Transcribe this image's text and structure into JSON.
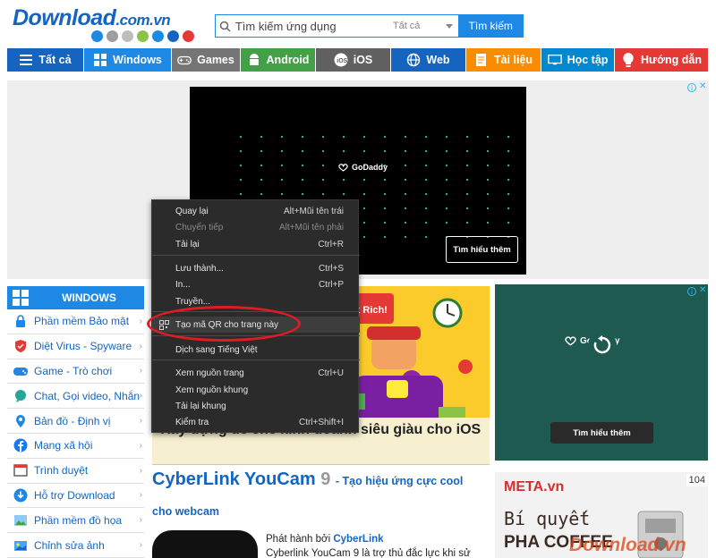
{
  "header": {
    "logo_text": "Download",
    "logo_suffix": ".com.vn",
    "logo_dot_colors": [
      "#1e88e5",
      "#9e9e9e",
      "#bdbdbd",
      "#8bc34a",
      "#1e88e5",
      "#1565c0",
      "#e53935"
    ],
    "search": {
      "placeholder": "Tìm kiếm ứng dụng",
      "filter": "Tất cả",
      "button": "Tìm kiếm"
    }
  },
  "nav": [
    {
      "label": "Tất cả",
      "color": "#1565c0",
      "icon": "menu-icon"
    },
    {
      "label": "Windows",
      "color": "#1e88e5",
      "icon": "windows-icon"
    },
    {
      "label": "Games",
      "color": "#757575",
      "icon": "gamepad-icon"
    },
    {
      "label": "Android",
      "color": "#43a047",
      "icon": "android-icon"
    },
    {
      "label": "iOS",
      "color": "#616161",
      "icon": "ios-icon"
    },
    {
      "label": "Web",
      "color": "#1565c0",
      "icon": "globe-icon"
    },
    {
      "label": "Tài liệu",
      "color": "#fb8c00",
      "icon": "document-icon"
    },
    {
      "label": "Học tập",
      "color": "#0288d1",
      "icon": "monitor-icon"
    },
    {
      "label": "Hướng dẫn",
      "color": "#e53935",
      "icon": "lightbulb-icon"
    }
  ],
  "ads": {
    "top_video": {
      "brand": "GoDaddy",
      "cta": "Tìm hiểu thêm"
    },
    "right_top": {
      "brand": "GoDaddy",
      "cta": "Tìm hiểu thêm"
    },
    "right_bottom": {
      "brand": "META.vn",
      "badge": "104",
      "line1": "Bí quyết",
      "line2": "PHA COFFEE"
    }
  },
  "sidebar": {
    "header": "WINDOWS",
    "items": [
      {
        "label": "Phần mềm Bảo mật",
        "icon": "lock-icon"
      },
      {
        "label": "Diệt Virus - Spyware",
        "icon": "shield-icon"
      },
      {
        "label": "Game - Trò chơi",
        "icon": "gamepad-icon"
      },
      {
        "label": "Chat, Gọi video, Nhắn",
        "icon": "chat-icon"
      },
      {
        "label": "Bản đồ - Định vị",
        "icon": "map-icon"
      },
      {
        "label": "Mạng xã hội",
        "icon": "facebook-icon"
      },
      {
        "label": "Trình duyệt",
        "icon": "browser-icon"
      },
      {
        "label": "Hỗ trợ Download",
        "icon": "download-icon"
      },
      {
        "label": "Phần mềm đồ họa",
        "icon": "graphics-icon"
      },
      {
        "label": "Chỉnh sửa ảnh",
        "icon": "photo-edit-icon"
      }
    ]
  },
  "content": {
    "banner_caption": "Xây dựng đế chế kinh doanh siêu giàu cho iOS",
    "article_title": "CyberLink YouCam",
    "article_version": "9",
    "article_subtitle_a": "- Tạo hiệu ứng cực cool",
    "article_subtitle_b": "cho webcam",
    "publisher_prefix": "Phát hành bởi",
    "publisher": "CyberLink",
    "description": "Cyberlink YouCam 9 là trợ thủ đắc lực khi sử"
  },
  "context_menu": {
    "items": [
      {
        "label": "Quay lại",
        "shortcut": "Alt+Mũi tên trái",
        "disabled": false
      },
      {
        "label": "Chuyển tiếp",
        "shortcut": "Alt+Mũi tên phải",
        "disabled": true
      },
      {
        "label": "Tải lại",
        "shortcut": "Ctrl+R",
        "disabled": false
      },
      {
        "label": "Lưu thành...",
        "shortcut": "Ctrl+S",
        "disabled": false
      },
      {
        "label": "In...",
        "shortcut": "Ctrl+P",
        "disabled": false
      },
      {
        "label": "Truyền...",
        "shortcut": "",
        "disabled": false
      },
      {
        "label": "Tạo mã QR cho trang này",
        "shortcut": "",
        "disabled": false
      },
      {
        "label": "Dịch sang Tiếng Việt",
        "shortcut": "",
        "disabled": false
      },
      {
        "label": "Xem nguồn trang",
        "shortcut": "Ctrl+U",
        "disabled": false
      },
      {
        "label": "Xem nguồn khung",
        "shortcut": "",
        "disabled": false
      },
      {
        "label": "Tải lại khung",
        "shortcut": "",
        "disabled": false
      },
      {
        "label": "Kiểm tra",
        "shortcut": "Ctrl+Shift+I",
        "disabled": false
      }
    ],
    "highlight_color": "#e01b24"
  },
  "watermark": "Download.vn"
}
